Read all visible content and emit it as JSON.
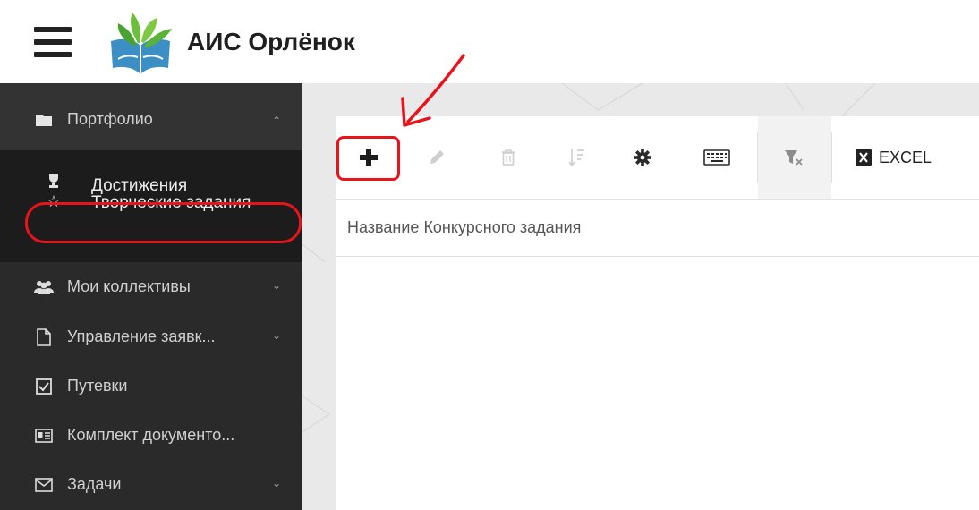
{
  "header": {
    "title": "АИС Орлёнок",
    "menu_icon": "hamburger-icon",
    "logo": "book-leaves-logo"
  },
  "sidebar": {
    "portfolio": {
      "label": "Портфолио",
      "icon": "folder-icon",
      "expanded": true
    },
    "portfolio_sub": [
      {
        "label": "Достижения",
        "icon": "trophy-icon"
      },
      {
        "label": "Творческие задания",
        "icon": "star-outline-icon",
        "active": true
      }
    ],
    "items": [
      {
        "label": "Мои коллективы",
        "icon": "users-icon",
        "has_chevron": true
      },
      {
        "label": "Управление заявк...",
        "icon": "file-icon",
        "has_chevron": true
      },
      {
        "label": "Путевки",
        "icon": "checkbox-icon",
        "has_chevron": false
      },
      {
        "label": "Комплект документо...",
        "icon": "id-card-icon",
        "has_chevron": false
      },
      {
        "label": "Задачи",
        "icon": "envelope-icon",
        "has_chevron": true
      }
    ]
  },
  "toolbar": {
    "buttons": [
      {
        "name": "add",
        "icon": "plus-icon",
        "enabled": true
      },
      {
        "name": "edit",
        "icon": "pencil-icon",
        "enabled": false
      },
      {
        "name": "delete",
        "icon": "trash-icon",
        "enabled": false
      },
      {
        "name": "sort",
        "icon": "sort-icon",
        "enabled": false
      },
      {
        "name": "settings",
        "icon": "gear-icon",
        "enabled": true
      },
      {
        "name": "keyboard",
        "icon": "keyboard-icon",
        "enabled": true
      },
      {
        "name": "clear-filter",
        "icon": "filter-clear-icon",
        "enabled": true
      }
    ],
    "excel_label": "EXCEL"
  },
  "table": {
    "columns": [
      "Название Конкурсного задания"
    ]
  },
  "colors": {
    "sidebar_bg": "#2a2a2a",
    "submenu_bg": "#1c1c1c",
    "annotation": "#e8141b"
  }
}
